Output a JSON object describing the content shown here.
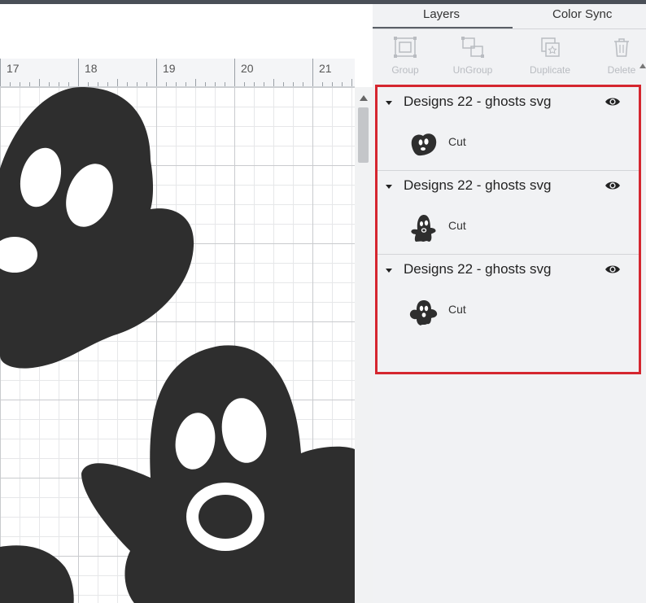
{
  "ruler": {
    "labels": [
      "17",
      "18",
      "19",
      "20",
      "21"
    ]
  },
  "panel": {
    "tabs": [
      {
        "label": "Layers"
      },
      {
        "label": "Color Sync"
      }
    ],
    "toolbar": {
      "group": "Group",
      "ungroup": "UnGroup",
      "duplicate": "Duplicate",
      "delete": "Delete"
    },
    "layers": [
      {
        "name": "Designs 22 - ghosts svg",
        "operation": "Cut"
      },
      {
        "name": "Designs 22 - ghosts svg",
        "operation": "Cut"
      },
      {
        "name": "Designs 22 - ghosts svg",
        "operation": "Cut"
      }
    ]
  },
  "colors": {
    "ghost": "#2e2e2e",
    "highlight": "#d5262f",
    "panel_bg": "#f1f2f4"
  }
}
